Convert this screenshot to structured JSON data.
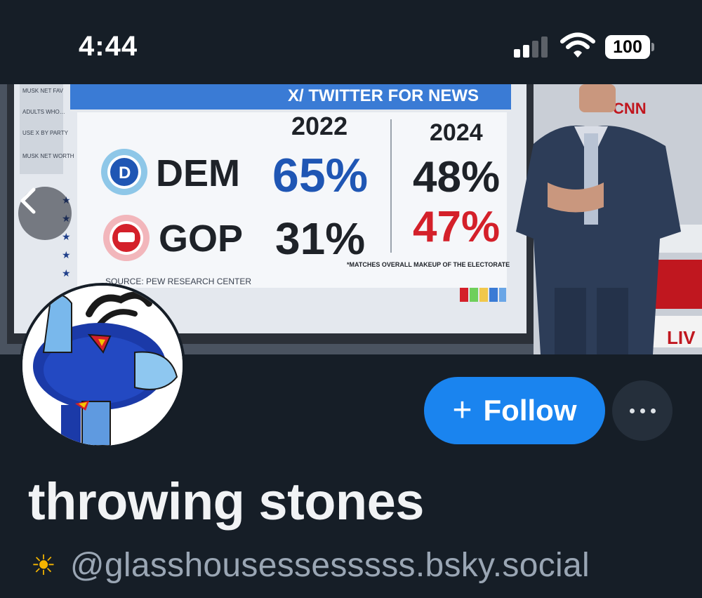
{
  "status_bar": {
    "time": "4:44",
    "battery": "100",
    "icons": [
      "signal-icon",
      "wifi-icon",
      "battery-icon"
    ]
  },
  "banner": {
    "tv_title": "X/ TWITTER FOR NEWS",
    "sidebar_labels": [
      "MUSK NET FAV",
      "ADULTS WHO…",
      "USE X BY PARTY",
      "MUSK NET WORTH"
    ],
    "col_2022": "2022",
    "col_2024": "2024",
    "dem_label": "DEM",
    "gop_label": "GOP",
    "dem_2022": "65%",
    "dem_2024": "48%",
    "gop_2022": "31%",
    "gop_2024": "47%",
    "dem_badge": "D",
    "footnote": "*MATCHES OVERALL MAKEUP OF THE ELECTORATE",
    "source": "SOURCE: PEW RESEARCH CENTER",
    "network": "CNN",
    "live": "LIV"
  },
  "profile": {
    "follow_label": "Follow",
    "follow_icon": "plus-icon",
    "more_icon": "ellipsis-icon",
    "display_name": "throwing stones",
    "handle_emoji": "☀",
    "handle": "@glasshousessesssss.bsky.social"
  },
  "colors": {
    "background": "#161e27",
    "accent": "#1a84ef",
    "dem_blue": "#1f56b4",
    "gop_red": "#d4202a",
    "handle_gray": "#9aa6b4"
  }
}
